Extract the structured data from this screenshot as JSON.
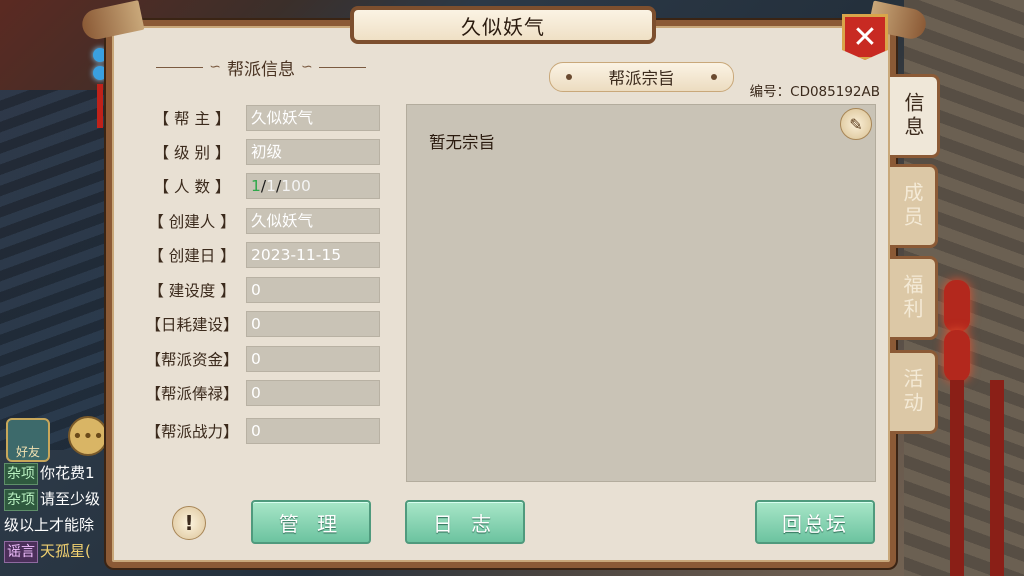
{
  "window": {
    "title": "久似妖气",
    "close_label": "✕"
  },
  "info": {
    "section_title": "帮派信息",
    "rows": [
      {
        "label": "【  帮  主  】",
        "value": "久似妖气"
      },
      {
        "label": "【  级  别  】",
        "value": "初级"
      },
      {
        "label": "【  人  数  】",
        "value_parts": {
          "online": "1",
          "sep1": "/",
          "current": "1",
          "sep2": "/",
          "max": "100"
        }
      },
      {
        "label": "【  创建人  】",
        "value": "久似妖气"
      },
      {
        "label": "【  创建日  】",
        "value": "2023-11-15"
      },
      {
        "label": "【  建设度  】",
        "value": "0"
      },
      {
        "label": "【日耗建设】",
        "value": "0"
      },
      {
        "label": "【帮派资金】",
        "value": "0"
      },
      {
        "label": "【帮派俸禄】",
        "value": "0"
      },
      {
        "label": "【帮派战力】",
        "value": "0"
      }
    ]
  },
  "motto": {
    "header": "帮派宗旨",
    "guild_id": "编号：CD085192AB",
    "text": "暂无宗旨"
  },
  "side_tabs": [
    {
      "label": "信息",
      "active": true
    },
    {
      "label": "成员",
      "active": false
    },
    {
      "label": "福利",
      "active": false
    },
    {
      "label": "活动",
      "active": false
    }
  ],
  "buttons": {
    "hint": "!",
    "manage": "管 理",
    "log": "日 志",
    "return": "回总坛"
  },
  "chat": {
    "friend_label": "好友",
    "lines": [
      {
        "tag": "杂项",
        "text": "你花费1"
      },
      {
        "tag": "杂项",
        "text": "请至少级"
      },
      {
        "tag": "",
        "text": "级以上才能除"
      },
      {
        "tag": "谣言",
        "text": "天孤星("
      }
    ]
  },
  "colors": {
    "accent_green": "#6cc3a0",
    "frame_brown": "#8b5a36",
    "close_red": "#c82a22",
    "online_green": "#2ea84a"
  }
}
